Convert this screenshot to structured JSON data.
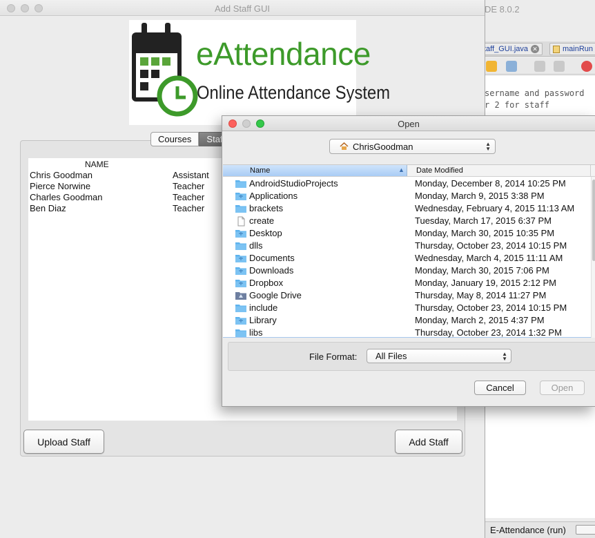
{
  "ide": {
    "title_fragment": "DE 8.0.2",
    "tabs": [
      "taff_GUI.java",
      "mainRun"
    ],
    "code_lines": [
      "sername and password",
      "r 2 for staff"
    ],
    "status_text": "E-Attendance (run)"
  },
  "main_window": {
    "title": "Add Staff GUI",
    "logo": {
      "brand": "eAttendance",
      "tagline": "Online Attendance System"
    },
    "tabs": [
      {
        "label": "Courses"
      },
      {
        "label": "Staff"
      }
    ],
    "table": {
      "name_header": "NAME",
      "rows": [
        {
          "name": "Chris Goodman",
          "role": "Assistant"
        },
        {
          "name": "Pierce Norwine",
          "role": "Teacher"
        },
        {
          "name": "Charles Goodman",
          "role": "Teacher"
        },
        {
          "name": "Ben Diaz",
          "role": "Teacher"
        }
      ]
    },
    "buttons": {
      "upload": "Upload Staff",
      "add": "Add Staff"
    }
  },
  "dialog": {
    "title": "Open",
    "location": "ChrisGoodman",
    "columns": {
      "name": "Name",
      "date": "Date Modified"
    },
    "files": [
      {
        "name": "AndroidStudioProjects",
        "date": "Monday, December 8, 2014 10:25 PM",
        "icon": "folder-icon"
      },
      {
        "name": "Applications",
        "date": "Monday, March 9, 2015 3:38 PM",
        "icon": "applications-folder-icon"
      },
      {
        "name": "brackets",
        "date": "Wednesday, February 4, 2015 11:13 AM",
        "icon": "folder-icon"
      },
      {
        "name": "create",
        "date": "Tuesday, March 17, 2015 6:37 PM",
        "icon": "document-icon"
      },
      {
        "name": "Desktop",
        "date": "Monday, March 30, 2015 10:35 PM",
        "icon": "desktop-folder-icon"
      },
      {
        "name": "dlls",
        "date": "Thursday, October 23, 2014 10:15 PM",
        "icon": "folder-icon"
      },
      {
        "name": "Documents",
        "date": "Wednesday, March 4, 2015 11:11 AM",
        "icon": "documents-folder-icon"
      },
      {
        "name": "Downloads",
        "date": "Monday, March 30, 2015 7:06 PM",
        "icon": "downloads-folder-icon"
      },
      {
        "name": "Dropbox",
        "date": "Monday, January 19, 2015 2:12 PM",
        "icon": "dropbox-folder-icon"
      },
      {
        "name": "Google Drive",
        "date": "Thursday, May 8, 2014 11:27 PM",
        "icon": "google-drive-folder-icon"
      },
      {
        "name": "include",
        "date": "Thursday, October 23, 2014 10:15 PM",
        "icon": "folder-icon"
      },
      {
        "name": "Library",
        "date": "Monday, March 2, 2015 4:37 PM",
        "icon": "library-folder-icon"
      },
      {
        "name": "libs",
        "date": "Thursday, October 23, 2014 1:32 PM",
        "icon": "folder-icon"
      }
    ],
    "file_format_label": "File Format:",
    "file_format_value": "All Files",
    "buttons": {
      "cancel": "Cancel",
      "open": "Open"
    }
  },
  "colors": {
    "folder_blue": "#5eb3ee",
    "brand_green": "#3d9a2a",
    "selection_blue": "#a9ccf5",
    "close_red": "#fc605c",
    "min_grey": "#cfcfcf",
    "zoom_green": "#34c84a"
  }
}
